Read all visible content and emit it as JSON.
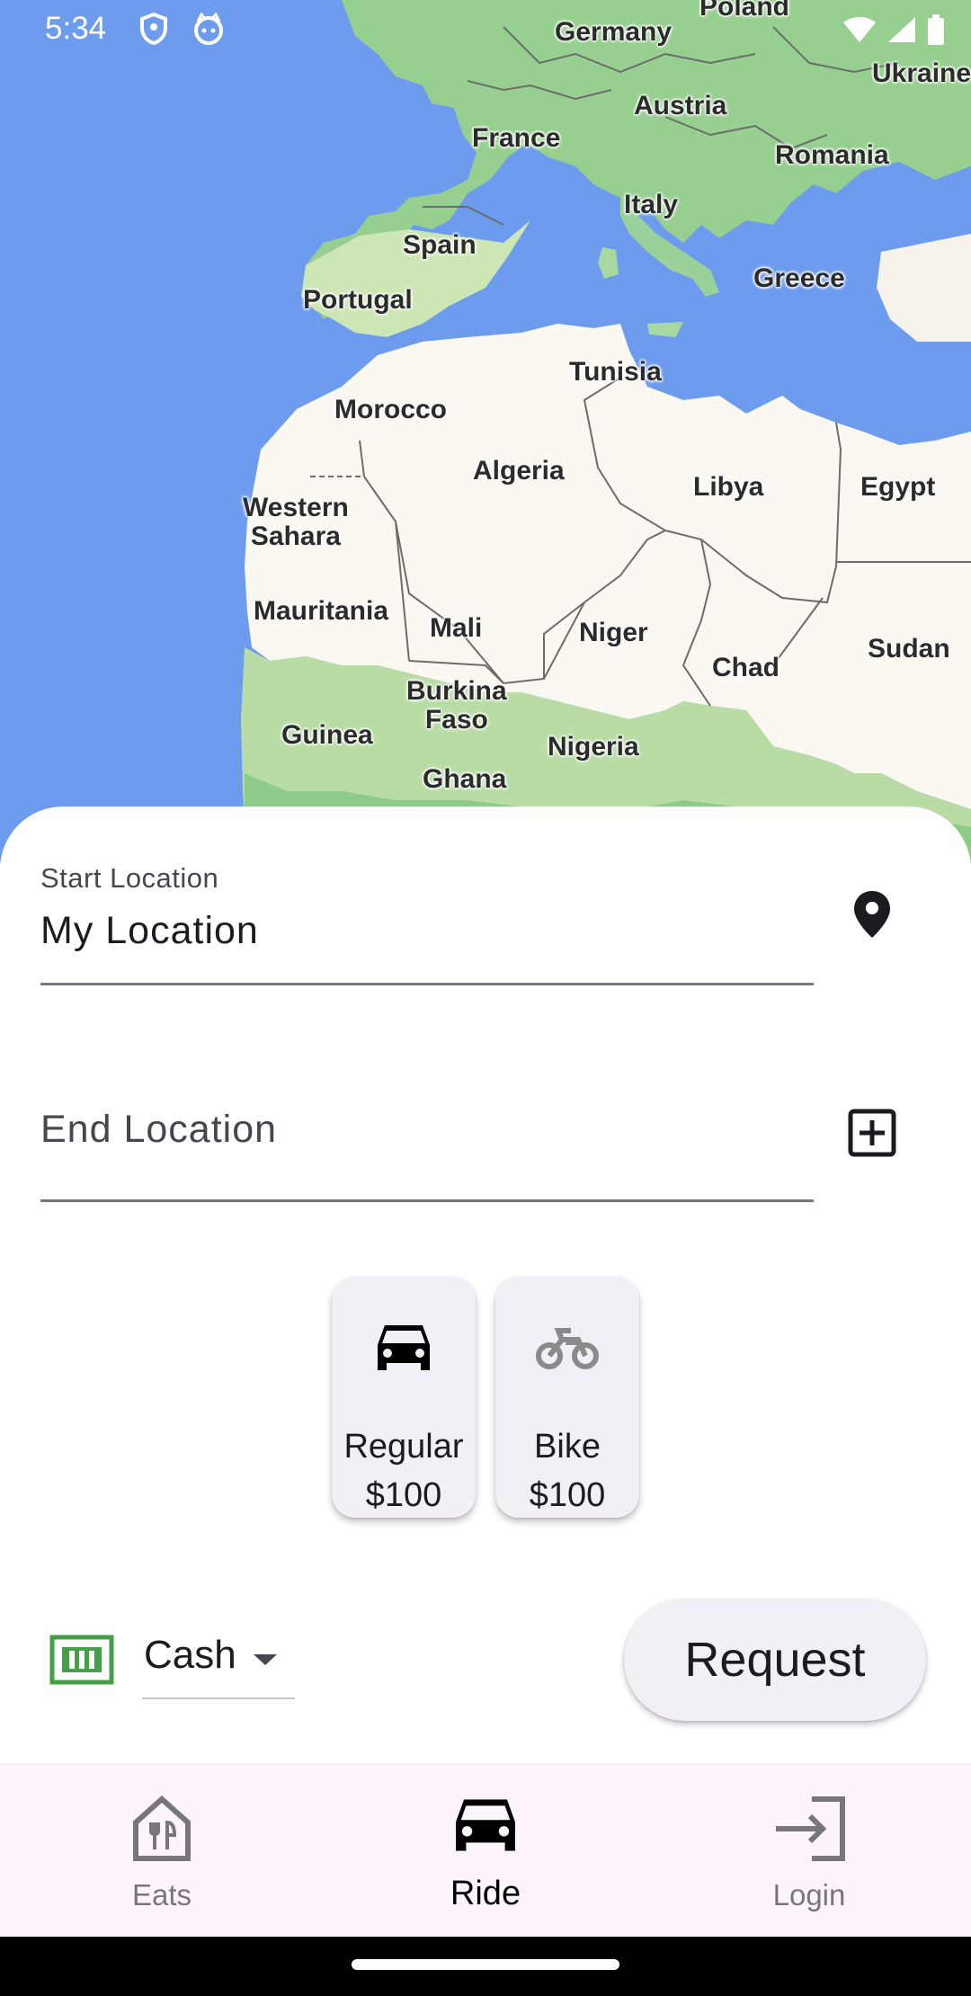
{
  "status_bar": {
    "time": "5:34"
  },
  "map": {
    "labels": {
      "poland": "Poland",
      "germany": "Germany",
      "ukraine": "Ukraine",
      "austria": "Austria",
      "france": "France",
      "romania": "Romania",
      "italy": "Italy",
      "spain": "Spain",
      "portugal": "Portugal",
      "greece": "Greece",
      "tunisia": "Tunisia",
      "morocco": "Morocco",
      "algeria": "Algeria",
      "libya": "Libya",
      "egypt": "Egypt",
      "western_sahara": "Western\nSahara",
      "mauritania": "Mauritania",
      "mali": "Mali",
      "niger": "Niger",
      "chad": "Chad",
      "sudan": "Sudan",
      "burkina_faso": "Burkina\nFaso",
      "guinea": "Guinea",
      "nigeria": "Nigeria",
      "ghana": "Ghana"
    }
  },
  "form": {
    "start": {
      "label": "Start Location",
      "value": "My Location",
      "icon": "location-pin-icon"
    },
    "end": {
      "placeholder": "End Location",
      "icon": "add-box-icon"
    }
  },
  "ride_options": [
    {
      "name": "Regular",
      "price": "$100",
      "icon": "car-icon",
      "selected": true
    },
    {
      "name": "Bike",
      "price": "$100",
      "icon": "bike-icon",
      "selected": false
    }
  ],
  "payment": {
    "value": "Cash",
    "icon": "cash-icon",
    "icon_color": "#43a047"
  },
  "request_button": {
    "label": "Request"
  },
  "bottom_nav": {
    "items": [
      {
        "label": "Eats",
        "icon": "restaurant-home-icon",
        "active": false
      },
      {
        "label": "Ride",
        "icon": "car-icon",
        "active": true
      },
      {
        "label": "Login",
        "icon": "login-icon",
        "active": false
      }
    ]
  }
}
